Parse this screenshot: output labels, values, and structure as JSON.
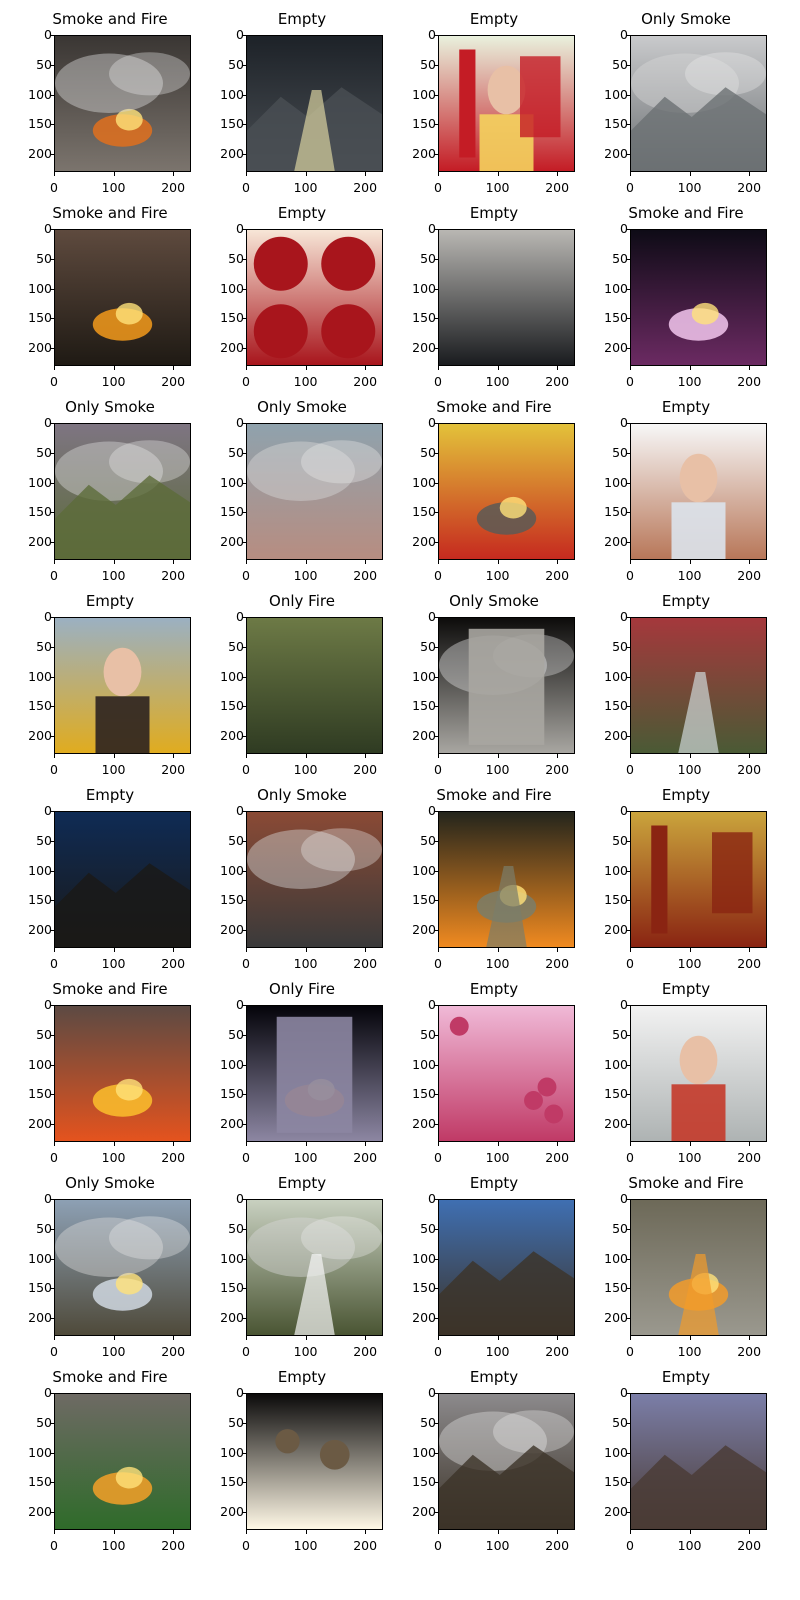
{
  "figure": {
    "x_ticks": [
      "0",
      "100",
      "200"
    ],
    "y_ticks": [
      "0",
      "50",
      "100",
      "150",
      "200"
    ],
    "panels": [
      {
        "title": "Smoke and Fire",
        "scene": "fire-ruins-smoke",
        "palette": [
          "#3a3633",
          "#7b746d",
          "#e0701d"
        ]
      },
      {
        "title": "Empty",
        "scene": "night-hillside-road",
        "palette": [
          "#1d2228",
          "#4a4f54",
          "#d9d2a0"
        ]
      },
      {
        "title": "Empty",
        "scene": "festival-couplet-poster",
        "palette": [
          "#e9f1dd",
          "#c41c25",
          "#f4d35e"
        ]
      },
      {
        "title": "Only Smoke",
        "scene": "misty-mountain-city",
        "palette": [
          "#c9cacc",
          "#6c7073",
          "#fafafa"
        ]
      },
      {
        "title": "Smoke and Fire",
        "scene": "grass-fire-line",
        "palette": [
          "#5e4a3e",
          "#1f1a14",
          "#f39a1b"
        ]
      },
      {
        "title": "Empty",
        "scene": "four-red-bowls",
        "palette": [
          "#f7e6d7",
          "#a8151c",
          "#1a0d0d"
        ]
      },
      {
        "title": "Empty",
        "scene": "black-bag-on-stone",
        "palette": [
          "#b9b7b3",
          "#1a1c1f",
          "#8a8d90"
        ]
      },
      {
        "title": "Smoke and Fire",
        "scene": "night-sky-glow",
        "palette": [
          "#0e0b16",
          "#6b2a62",
          "#f3c7ef"
        ]
      },
      {
        "title": "Only Smoke",
        "scene": "forest-slope-smoke",
        "palette": [
          "#7e7582",
          "#5c6b3a",
          "#e8e4ee"
        ]
      },
      {
        "title": "Only Smoke",
        "scene": "hazy-building-smoke",
        "palette": [
          "#8fa2ad",
          "#b78d81",
          "#3a4550"
        ]
      },
      {
        "title": "Smoke and Fire",
        "scene": "burning-tram",
        "palette": [
          "#e3c23a",
          "#c62a1f",
          "#5a5a56"
        ]
      },
      {
        "title": "Empty",
        "scene": "portrait-long-hair",
        "palette": [
          "#f7f7f7",
          "#b87759",
          "#dbe3ec"
        ]
      },
      {
        "title": "Empty",
        "scene": "portrait-yellow-jacket",
        "palette": [
          "#9bb0c2",
          "#e0ac1f",
          "#2c2220"
        ]
      },
      {
        "title": "Only Fire",
        "scene": "green-forest-building",
        "palette": [
          "#6d7a46",
          "#2f3b22",
          "#b07a5a"
        ]
      },
      {
        "title": "Only Smoke",
        "scene": "window-smoky-view",
        "palette": [
          "#0d0c0b",
          "#a8a6a1",
          "#6d6a63"
        ]
      },
      {
        "title": "Empty",
        "scene": "red-running-path",
        "palette": [
          "#a5383c",
          "#4a5a35",
          "#cfd7d9"
        ]
      },
      {
        "title": "Empty",
        "scene": "dusk-mountains",
        "palette": [
          "#0f2b55",
          "#1a1917",
          "#79a2c7"
        ]
      },
      {
        "title": "Only Smoke",
        "scene": "brick-building-smoke",
        "palette": [
          "#8a4a35",
          "#3a3a3a",
          "#e8e8e8"
        ]
      },
      {
        "title": "Smoke and Fire",
        "scene": "burning-bus-road",
        "palette": [
          "#24251c",
          "#f08a20",
          "#7a7e6a"
        ]
      },
      {
        "title": "Empty",
        "scene": "temple-advert",
        "palette": [
          "#caa43c",
          "#8a2412",
          "#f1e6c3"
        ]
      },
      {
        "title": "Smoke and Fire",
        "scene": "aerial-fire-glow",
        "palette": [
          "#5c4a43",
          "#e4531e",
          "#fbc02d"
        ]
      },
      {
        "title": "Only Fire",
        "scene": "building-fire-frame",
        "palette": [
          "#04040a",
          "#8c86a2",
          "#f08020"
        ]
      },
      {
        "title": "Empty",
        "scene": "pink-roses",
        "palette": [
          "#f0b9d7",
          "#c03a66",
          "#3d5a2d"
        ]
      },
      {
        "title": "Empty",
        "scene": "couple-workwear",
        "palette": [
          "#f2f2f2",
          "#aeb3b3",
          "#c43a2a"
        ]
      },
      {
        "title": "Only Smoke",
        "scene": "smoky-bush-fire",
        "palette": [
          "#8da0b4",
          "#4f4a3a",
          "#d0d8e2"
        ]
      },
      {
        "title": "Empty",
        "scene": "foggy-tree-road",
        "palette": [
          "#c8d0c0",
          "#4a5533",
          "#f5f5f5"
        ]
      },
      {
        "title": "Empty",
        "scene": "rock-valley-fisheye",
        "palette": [
          "#3f6fb2",
          "#3c3328",
          "#b29c84"
        ]
      },
      {
        "title": "Smoke and Fire",
        "scene": "aerial-road-fire",
        "palette": [
          "#6d6958",
          "#9a988e",
          "#f29b2a"
        ]
      },
      {
        "title": "Smoke and Fire",
        "scene": "burning-farm-vehicles",
        "palette": [
          "#6e6a64",
          "#2f6b2a",
          "#f5a028"
        ]
      },
      {
        "title": "Empty",
        "scene": "night-headlights",
        "palette": [
          "#0b0a0a",
          "#fff8e6",
          "#6b5a44"
        ]
      },
      {
        "title": "Empty",
        "scene": "cloudy-hills-fisheye",
        "palette": [
          "#8c8a8c",
          "#3c3328",
          "#c9c6c9"
        ]
      },
      {
        "title": "Empty",
        "scene": "purple-dusk-valley",
        "palette": [
          "#7b7ea8",
          "#4a3b34",
          "#c89b88"
        ]
      }
    ]
  }
}
